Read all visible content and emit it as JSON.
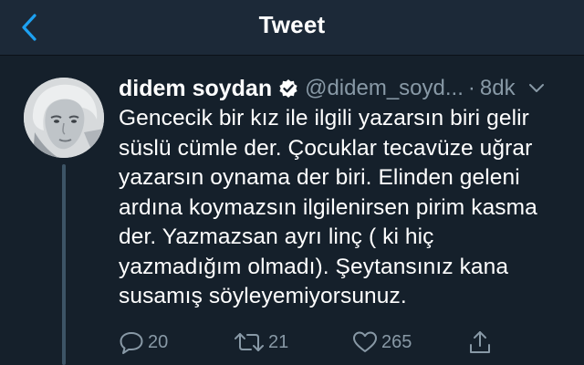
{
  "header": {
    "title": "Tweet",
    "back_icon": "chevron-left-icon",
    "accent_color": "#1da1f2"
  },
  "tweet": {
    "author_name": "didem soydan",
    "verified": true,
    "handle": "@didem_soyd...",
    "separator": "·",
    "time": "8dk",
    "text_lines": [
      "Gencecik bir kız ile ilgili yazarsın biri gelir",
      "süslü cümle der. Çocuklar tecavüze uğrar",
      "yazarsın oynama der biri. Elinden geleni",
      "ardına koymazsın ilgilenirsen pirim kasma",
      "der. Yazmazsan ayrı linç ( ki hiç",
      "yazmadığım olmadı). Şeytansınız kana",
      "susamış söyleyemiyorsunuz."
    ],
    "actions": {
      "reply": {
        "icon": "reply-icon",
        "count": "20"
      },
      "retweet": {
        "icon": "retweet-icon",
        "count": "21"
      },
      "like": {
        "icon": "heart-icon",
        "count": "265"
      },
      "share": {
        "icon": "share-icon"
      }
    }
  },
  "colors": {
    "background": "#15202b",
    "header_background": "#1c2938",
    "secondary_text": "#8899a6",
    "thread_line": "#3d5466"
  }
}
